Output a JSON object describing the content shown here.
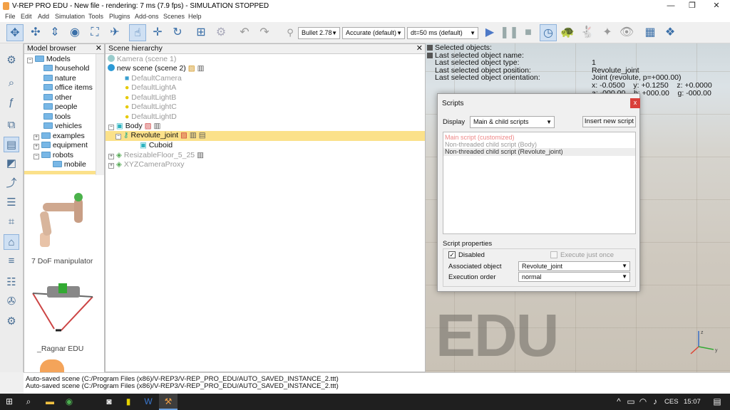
{
  "window": {
    "title": "V-REP PRO EDU - New file - rendering: 7 ms (7.9 fps) - SIMULATION STOPPED",
    "min": "—",
    "max": "❐",
    "close": "✕"
  },
  "menu": [
    "File",
    "Edit",
    "Add",
    "Simulation",
    "Tools",
    "Plugins",
    "Add-ons",
    "Scenes",
    "Help"
  ],
  "toolbar": {
    "engine": "Bullet 2.78",
    "accuracy": "Accurate (default)",
    "dt": "dt=50 ms (default)"
  },
  "model_browser": {
    "title": "Model browser",
    "close": "✕",
    "items": [
      "Models",
      "household",
      "nature",
      "office items",
      "other",
      "people",
      "tools",
      "vehicles",
      "examples",
      "equipment",
      "robots",
      "mobile"
    ],
    "thumbs": [
      "7 DoF manipulator",
      "_Ragnar EDU"
    ]
  },
  "hierarchy": {
    "title": "Scene hierarchy",
    "close": "✕",
    "items": [
      "Kamera (scene 1)",
      "new scene (scene 2)",
      "DefaultCamera",
      "DefaultLightA",
      "DefaultLightB",
      "DefaultLightC",
      "DefaultLightD",
      "Body",
      "Revolute_joint",
      "Cuboid",
      "ResizableFloor_5_25",
      "XYZCameraProxy"
    ]
  },
  "info": {
    "labels": [
      "Selected objects:",
      "Last selected object name:",
      "Last selected object type:",
      "Last selected object position:",
      "Last selected object orientation:"
    ],
    "values": [
      "1",
      "Revolute_joint",
      "Joint (revolute, p=+000.00)",
      "x: -0.0500    y: +0.1250    z: +0.0000",
      "a: -000.00    b: +000.00    g: -000.00"
    ]
  },
  "watermark": "EDU",
  "scripts_dialog": {
    "title": "Scripts",
    "close": "x",
    "display_label": "Display",
    "display_value": "Main & child scripts",
    "insert_button": "Insert new script",
    "scripts": [
      "Main script (customized)",
      "Non-threaded child script (Body)",
      "Non-threaded child script (Revolute_joint)"
    ],
    "props_title": "Script properties",
    "disabled_label": "Disabled",
    "disabled_checked": true,
    "exec_once_label": "Execute just once",
    "assoc_label": "Associated object",
    "assoc_value": "Revolute_joint",
    "order_label": "Execution order",
    "order_value": "normal"
  },
  "status": [
    "Auto-saved scene (C:/Program Files (x86)/V-REP3/V-REP_PRO_EDU/AUTO_SAVED_INSTANCE_2.ttt)",
    "Auto-saved scene (C:/Program Files (x86)/V-REP3/V-REP_PRO_EDU/AUTO_SAVED_INSTANCE_2.ttt)"
  ],
  "taskbar": {
    "lang": "CES",
    "time": "15:07"
  },
  "colors": {
    "accent": "#3a6fa8",
    "selected_row": "#fbe18a",
    "dialog_close": "#d9403a"
  }
}
